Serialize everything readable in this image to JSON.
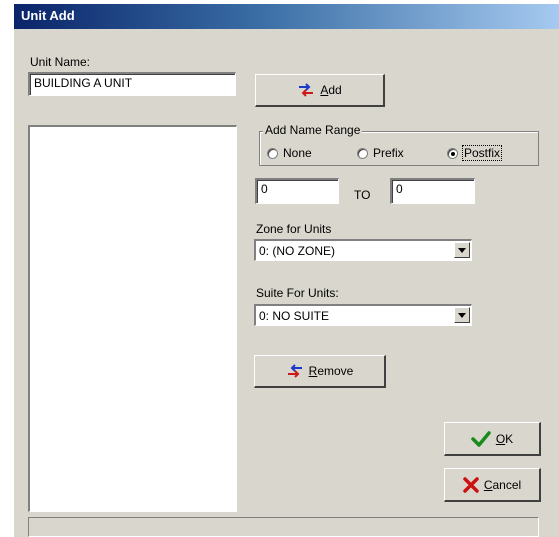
{
  "window": {
    "title": "Unit Add"
  },
  "unit_name": {
    "label": "Unit Name:",
    "value": "BUILDING A UNIT"
  },
  "add_button": {
    "accel": "A",
    "rest": "dd"
  },
  "name_range": {
    "legend": "Add Name Range",
    "options": [
      {
        "label": "None",
        "selected": false
      },
      {
        "label": "Prefix",
        "selected": false
      },
      {
        "label": "Postfix",
        "selected": true
      }
    ],
    "from_value": "0",
    "to_label": "TO",
    "to_value": "0"
  },
  "zone": {
    "label": "Zone for Units",
    "selected": "0: (NO ZONE)"
  },
  "suite": {
    "label": "Suite For Units:",
    "selected": "0: NO SUITE"
  },
  "remove_button": {
    "accel": "R",
    "rest": "emove"
  },
  "ok_button": {
    "accel": "O",
    "rest": "K"
  },
  "cancel_button": {
    "accel": "C",
    "rest": "ancel"
  },
  "colors": {
    "title_start": "#0a246a",
    "title_end": "#a6caf0",
    "face": "#d9d6cd",
    "ok_check": "#1a8a1a",
    "cancel_x": "#cc1111"
  },
  "icons": {
    "add": "add-arrows-icon",
    "remove": "remove-arrows-icon",
    "ok": "checkmark-icon",
    "cancel": "x-icon",
    "dropdown": "chevron-down-icon"
  }
}
